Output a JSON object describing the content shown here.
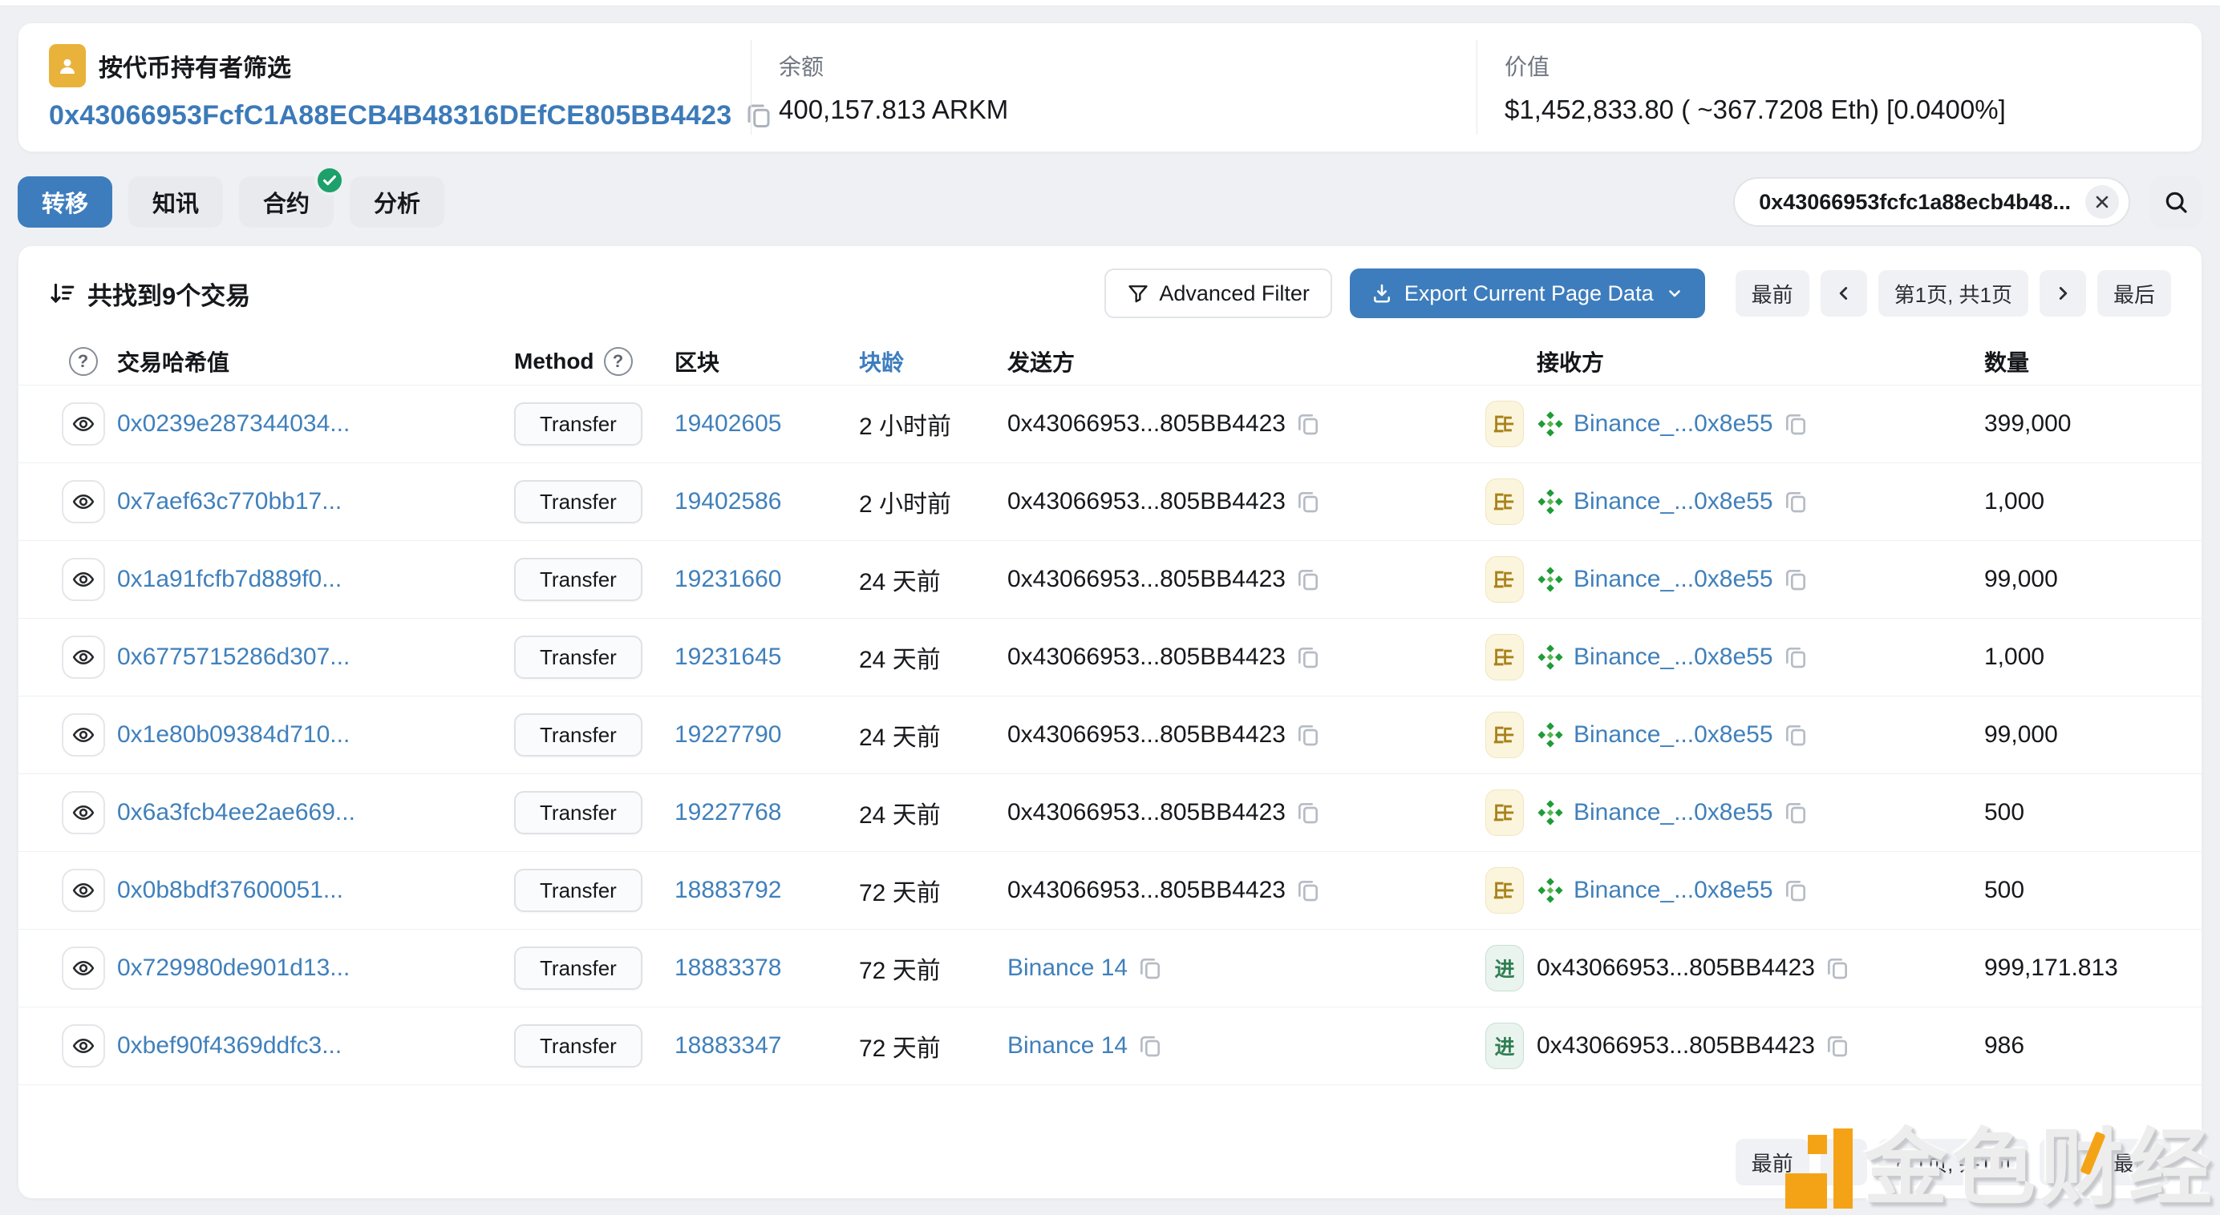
{
  "header": {
    "filter_title": "按代币持有者筛选",
    "address": "0x43066953FcfC1A88ECB4B48316DEfCE805BB4423",
    "balance_label": "余额",
    "balance_value": "400,157.813 ARKM",
    "value_label": "价值",
    "value_value": "$1,452,833.80 ( ~367.7208 Eth) [0.0400%]"
  },
  "tabs": [
    {
      "label": "转移",
      "active": true
    },
    {
      "label": "知讯",
      "active": false
    },
    {
      "label": "合约",
      "active": false,
      "badge": "verified-check"
    },
    {
      "label": "分析",
      "active": false
    }
  ],
  "search": {
    "value": "0x43066953fcfc1a88ecb4b48..."
  },
  "table": {
    "summary": "共找到9个交易",
    "advanced_filter_label": "Advanced Filter",
    "export_label": "Export Current Page Data",
    "pagination": {
      "first": "最前",
      "page_info": "第1页, 共1页",
      "last": "最后"
    },
    "columns": {
      "hash": "交易哈希值",
      "method": "Method",
      "block": "区块",
      "age": "块龄",
      "from": "发送方",
      "to": "接收方",
      "amount": "数量"
    },
    "rows": [
      {
        "hash": "0x0239e287344034...",
        "method": "Transfer",
        "block": "19402605",
        "age": "2 小时前",
        "from": "0x43066953...805BB4423",
        "dir": "出",
        "to": "Binance_...0x8e55",
        "amount": "399,000"
      },
      {
        "hash": "0x7aef63c770bb17...",
        "method": "Transfer",
        "block": "19402586",
        "age": "2 小时前",
        "from": "0x43066953...805BB4423",
        "dir": "出",
        "to": "Binance_...0x8e55",
        "amount": "1,000"
      },
      {
        "hash": "0x1a91fcfb7d889f0...",
        "method": "Transfer",
        "block": "19231660",
        "age": "24 天前",
        "from": "0x43066953...805BB4423",
        "dir": "出",
        "to": "Binance_...0x8e55",
        "amount": "99,000"
      },
      {
        "hash": "0x6775715286d307...",
        "method": "Transfer",
        "block": "19231645",
        "age": "24 天前",
        "from": "0x43066953...805BB4423",
        "dir": "出",
        "to": "Binance_...0x8e55",
        "amount": "1,000"
      },
      {
        "hash": "0x1e80b09384d710...",
        "method": "Transfer",
        "block": "19227790",
        "age": "24 天前",
        "from": "0x43066953...805BB4423",
        "dir": "出",
        "to": "Binance_...0x8e55",
        "amount": "99,000"
      },
      {
        "hash": "0x6a3fcb4ee2ae669...",
        "method": "Transfer",
        "block": "19227768",
        "age": "24 天前",
        "from": "0x43066953...805BB4423",
        "dir": "出",
        "to": "Binance_...0x8e55",
        "amount": "500"
      },
      {
        "hash": "0x0b8bdf37600051...",
        "method": "Transfer",
        "block": "18883792",
        "age": "72 天前",
        "from": "0x43066953...805BB4423",
        "dir": "出",
        "to": "Binance_...0x8e55",
        "amount": "500"
      },
      {
        "hash": "0x729980de901d13...",
        "method": "Transfer",
        "block": "18883378",
        "age": "72 天前",
        "from": "Binance 14",
        "dir": "进",
        "to": "0x43066953...805BB4423",
        "amount": "999,171.813"
      },
      {
        "hash": "0xbef90f4369ddfc3...",
        "method": "Transfer",
        "block": "18883347",
        "age": "72 天前",
        "from": "Binance 14",
        "dir": "进",
        "to": "0x43066953...805BB4423",
        "amount": "986"
      }
    ]
  },
  "watermark": {
    "text": "金色财经"
  },
  "colors": {
    "accent_blue": "#3d7dbd",
    "link_blue": "#4080bb",
    "out_badge": "#fcf5dd",
    "in_badge": "#eaf4ee",
    "binance_green": "#1f9b38",
    "brand_orange": "#f5a316"
  }
}
